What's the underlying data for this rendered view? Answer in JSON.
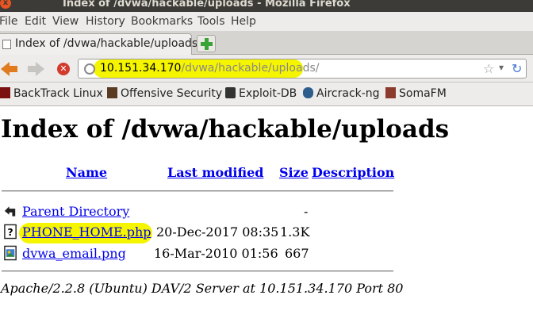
{
  "window": {
    "title": "Index of /dvwa/hackable/uploads - Mozilla Firefox",
    "close_glyph": "x"
  },
  "menu": [
    "File",
    "Edit",
    "View",
    "History",
    "Bookmarks",
    "Tools",
    "Help"
  ],
  "tab": {
    "label": "Index of /dvwa/hackable/uploads"
  },
  "url": {
    "host": "10.151.34.170",
    "path": "/dvwa/hackable/uploads/",
    "highlight_color": "#f5f500"
  },
  "bookmarks": [
    "BackTrack Linux",
    "Offensive Security",
    "Exploit-DB",
    "Aircrack-ng",
    "SomaFM"
  ],
  "page": {
    "title": "Index of /dvwa/hackable/uploads",
    "columns": {
      "name": "Name",
      "last_modified": "Last modified",
      "size": "Size",
      "description": "Description"
    },
    "parent": {
      "label": "Parent Directory",
      "size": "-"
    },
    "files": [
      {
        "name": "PHONE_HOME.php",
        "modified": "20-Dec-2017 08:35",
        "size": "1.3K",
        "icon": "unknown-file-icon",
        "highlighted": true
      },
      {
        "name": "dvwa_email.png",
        "modified": "16-Mar-2010 01:56",
        "size": "667",
        "icon": "image-file-icon",
        "highlighted": false
      }
    ],
    "server_signature": "Apache/2.2.8 (Ubuntu) DAV/2 Server at 10.151.34.170 Port 80"
  }
}
